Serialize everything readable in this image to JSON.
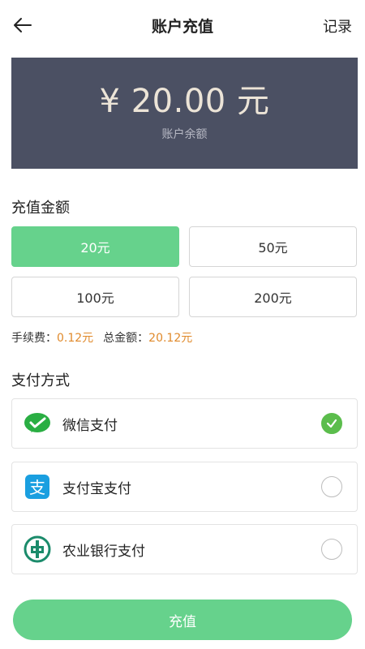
{
  "header": {
    "title": "账户充值",
    "record_label": "记录"
  },
  "balance": {
    "amount": "¥ 20.00 元",
    "label": "账户余额"
  },
  "recharge": {
    "section_title": "充值金额",
    "options": [
      "20元",
      "50元",
      "100元",
      "200元"
    ],
    "selected_index": 0,
    "fee_label": "手续费：",
    "fee_value": "0.12元",
    "total_label": "总金额：",
    "total_value": "20.12元"
  },
  "payment": {
    "section_title": "支付方式",
    "methods": [
      {
        "label": "微信支付",
        "icon": "wechat-pay-icon",
        "checked": true
      },
      {
        "label": "支付宝支付",
        "icon": "alipay-icon",
        "checked": false
      },
      {
        "label": "农业银行支付",
        "icon": "abc-bank-icon",
        "checked": false
      }
    ]
  },
  "submit": {
    "label": "充值"
  },
  "colors": {
    "accent_green": "#66d28c",
    "balance_bg": "#4b5063",
    "fee_orange": "#e08a2c",
    "check_green": "#5bbd4c",
    "alipay_blue": "#1a9fe0",
    "abc_green": "#1b8b6b"
  }
}
